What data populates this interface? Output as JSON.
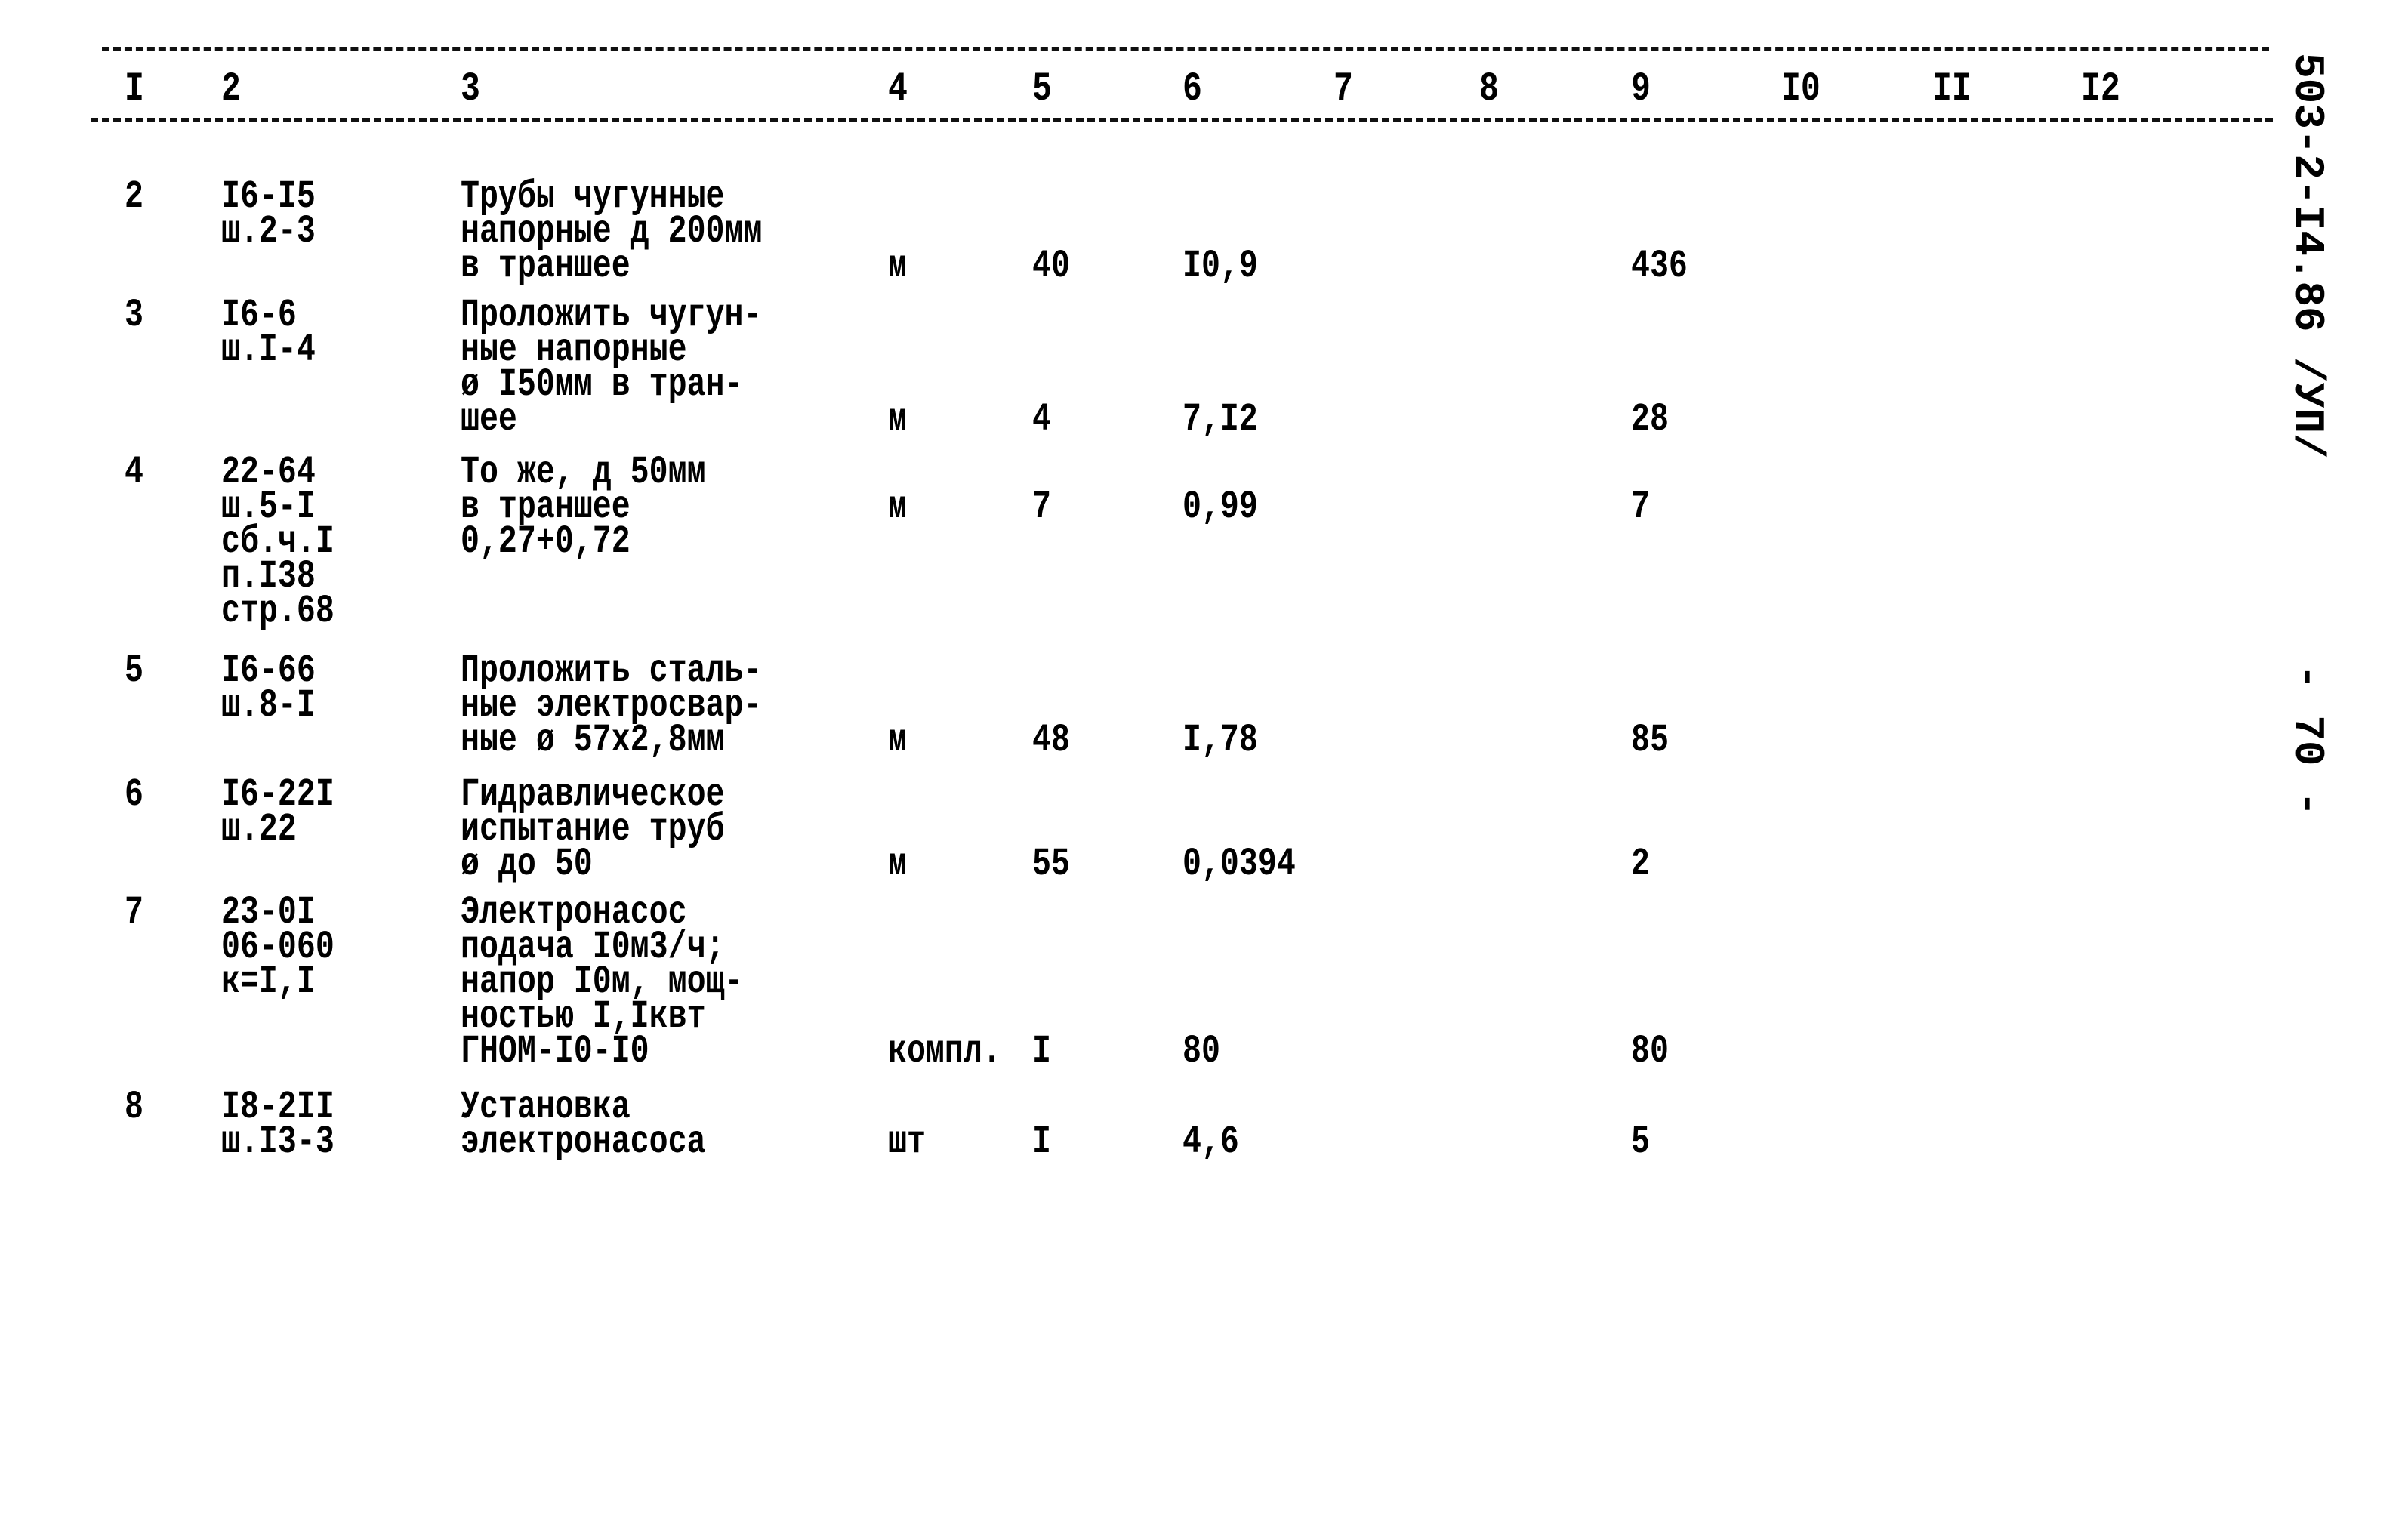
{
  "header": {
    "columns": [
      "I",
      "2",
      "3",
      "4",
      "5",
      "6",
      "7",
      "8",
      "9",
      "I0",
      "II",
      "I2"
    ]
  },
  "side": {
    "doc_code": "503-2-I4.86 /УП/",
    "page_number": "- 70 -"
  },
  "rows": [
    {
      "n": "2",
      "ref": [
        "I6-I5",
        "ш.2-3"
      ],
      "desc": [
        "Трубы чугунные",
        "напорные д 200мм",
        "в траншее"
      ],
      "unit": "м",
      "qty": "40",
      "c6": "I0,9",
      "c9": "436",
      "vline": 2
    },
    {
      "n": "3",
      "ref": [
        "I6-6",
        "ш.I-4"
      ],
      "desc": [
        "Проложить чугун-",
        "ные напорные",
        "ø I50мм в тран-",
        "шее"
      ],
      "unit": "м",
      "qty": "4",
      "c6": "7,I2",
      "c9": "28",
      "vline": 3
    },
    {
      "n": "4",
      "ref": [
        "22-64",
        "ш.5-I",
        "сб.ч.I",
        "п.I38",
        "стр.68"
      ],
      "desc": [
        "То же, д 50мм",
        "в траншее",
        "0,27+0,72"
      ],
      "unit": "м",
      "qty": "7",
      "c6": "0,99",
      "c9": "7",
      "vline": 1
    },
    {
      "n": "5",
      "ref": [
        "I6-66",
        "ш.8-I"
      ],
      "desc": [
        "Проложить сталь-",
        "ные электросвар-",
        "ные ø 57х2,8мм"
      ],
      "unit": "м",
      "qty": "48",
      "c6": "I,78",
      "c9": "85",
      "vline": 2
    },
    {
      "n": "6",
      "ref": [
        "I6-22I",
        "ш.22"
      ],
      "desc": [
        "Гидравлическое",
        "испытание труб",
        "ø до 50"
      ],
      "unit": "м",
      "qty": "55",
      "c6": "0,0394",
      "c9": "2",
      "vline": 2
    },
    {
      "n": "7",
      "ref": [
        "23-0I",
        "06-060",
        "к=I,I"
      ],
      "desc": [
        "Электронасос",
        "подача I0м3/ч;",
        "напор I0м, мощ-",
        "ностью I,Iквт",
        "ГНОМ-I0-I0"
      ],
      "unit": "компл.",
      "qty": "I",
      "c6": "80",
      "c9": "80",
      "vline": 4
    },
    {
      "n": "8",
      "ref": [
        "I8-2II",
        "ш.I3-3"
      ],
      "desc": [
        "Установка",
        "электронасоса"
      ],
      "unit": "шт",
      "qty": "I",
      "c6": "4,6",
      "c9": "5",
      "vline": 1
    }
  ]
}
